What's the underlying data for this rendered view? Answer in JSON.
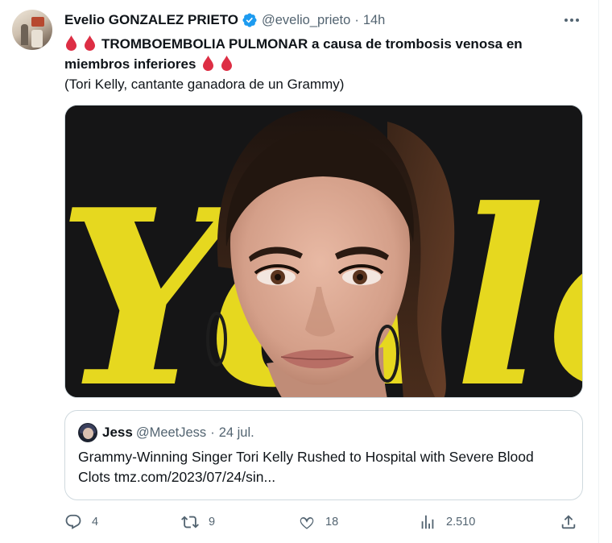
{
  "tweet": {
    "author_name": "Evelio GONZALEZ PRIETO",
    "handle": "@evelio_prieto",
    "separator": "·",
    "time": "14h",
    "line1": "TROMBOEMBOLIA PULMONAR a causa de trombosis venosa en",
    "line2": "miembros inferiores",
    "line3": "(Tori Kelly, cantante ganadora de un Grammy)",
    "image_backdrop_text": "Yello"
  },
  "quote": {
    "name": "Jess",
    "handle": "@MeetJess",
    "separator": "·",
    "time": "24 jul.",
    "text": "Grammy-Winning Singer Tori Kelly Rushed to Hospital with Severe Blood Clots tmz.com/2023/07/24/sin..."
  },
  "actions": {
    "replies": "4",
    "retweets": "9",
    "likes": "18",
    "views": "2.510"
  },
  "colors": {
    "verified": "#1d9bf0",
    "drop": "#dd2e44",
    "muted": "#536471",
    "backdrop_yellow": "#e6d81f"
  },
  "icons": [
    "verified-badge-icon",
    "more-icon",
    "blood-drop-icon",
    "reply-icon",
    "retweet-icon",
    "like-icon",
    "views-icon",
    "share-icon"
  ]
}
